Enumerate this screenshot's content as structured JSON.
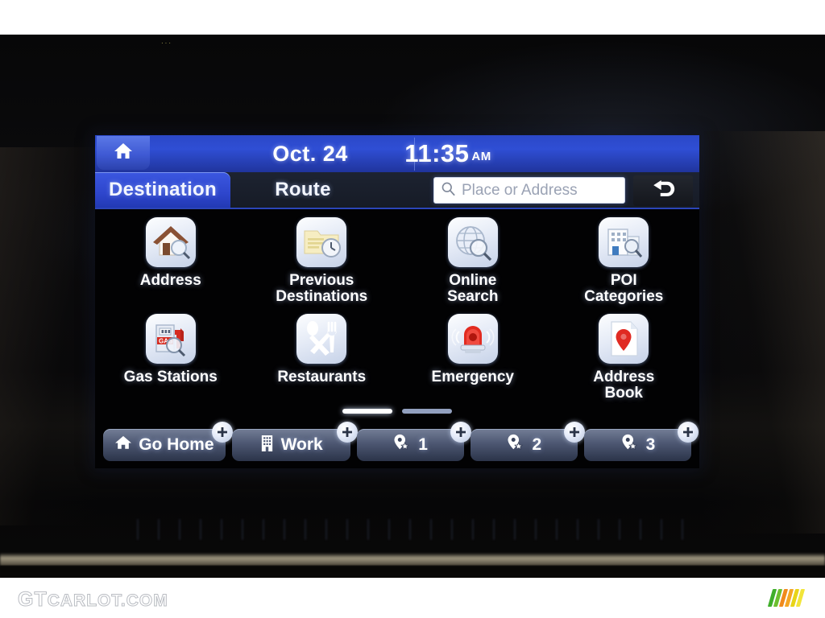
{
  "header": {
    "home_icon": "home-icon",
    "date": "Oct. 24",
    "time": "11:35",
    "ampm": "AM"
  },
  "tabs": [
    {
      "label": "Destination",
      "active": true
    },
    {
      "label": "Route",
      "active": false
    }
  ],
  "search": {
    "placeholder": "Place or Address",
    "icon": "search-icon"
  },
  "back_button": {
    "icon": "back-arrow-icon"
  },
  "grid": {
    "items": [
      {
        "label_line1": "Address",
        "label_line2": "",
        "icon": "house-search-icon"
      },
      {
        "label_line1": "Previous",
        "label_line2": "Destinations",
        "icon": "folder-clock-icon"
      },
      {
        "label_line1": "Online",
        "label_line2": "Search",
        "icon": "globe-search-icon"
      },
      {
        "label_line1": "POI",
        "label_line2": "Categories",
        "icon": "building-search-icon"
      },
      {
        "label_line1": "Gas Stations",
        "label_line2": "",
        "icon": "fuel-pump-search-icon"
      },
      {
        "label_line1": "Restaurants",
        "label_line2": "",
        "icon": "fork-spoon-icon"
      },
      {
        "label_line1": "Emergency",
        "label_line2": "",
        "icon": "siren-icon"
      },
      {
        "label_line1": "Address",
        "label_line2": "Book",
        "icon": "map-pin-page-icon"
      }
    ]
  },
  "pager": {
    "pages": 2,
    "current": 1
  },
  "shortcuts": [
    {
      "label": "Go Home",
      "icon": "home-icon",
      "add_icon": "plus-icon"
    },
    {
      "label": "Work",
      "icon": "building-icon",
      "add_icon": "plus-icon"
    },
    {
      "label": "1",
      "icon": "pin-star-icon",
      "add_icon": "plus-icon"
    },
    {
      "label": "2",
      "icon": "pin-star-icon",
      "add_icon": "plus-icon"
    },
    {
      "label": "3",
      "icon": "pin-star-icon",
      "add_icon": "plus-icon"
    }
  ],
  "watermark": {
    "prefix": "GT",
    "suffix": "CARLOT.COM",
    "logo_colors": [
      "#3fae2a",
      "#6cbf2e",
      "#f08a1c",
      "#f5a623",
      "#e8d417",
      "#f2e53a"
    ]
  },
  "colors": {
    "header_blue": "#2f4ed4",
    "active_tab": "#3b57e0",
    "screen_bg": "#020203",
    "accent_white": "#ffffff"
  }
}
